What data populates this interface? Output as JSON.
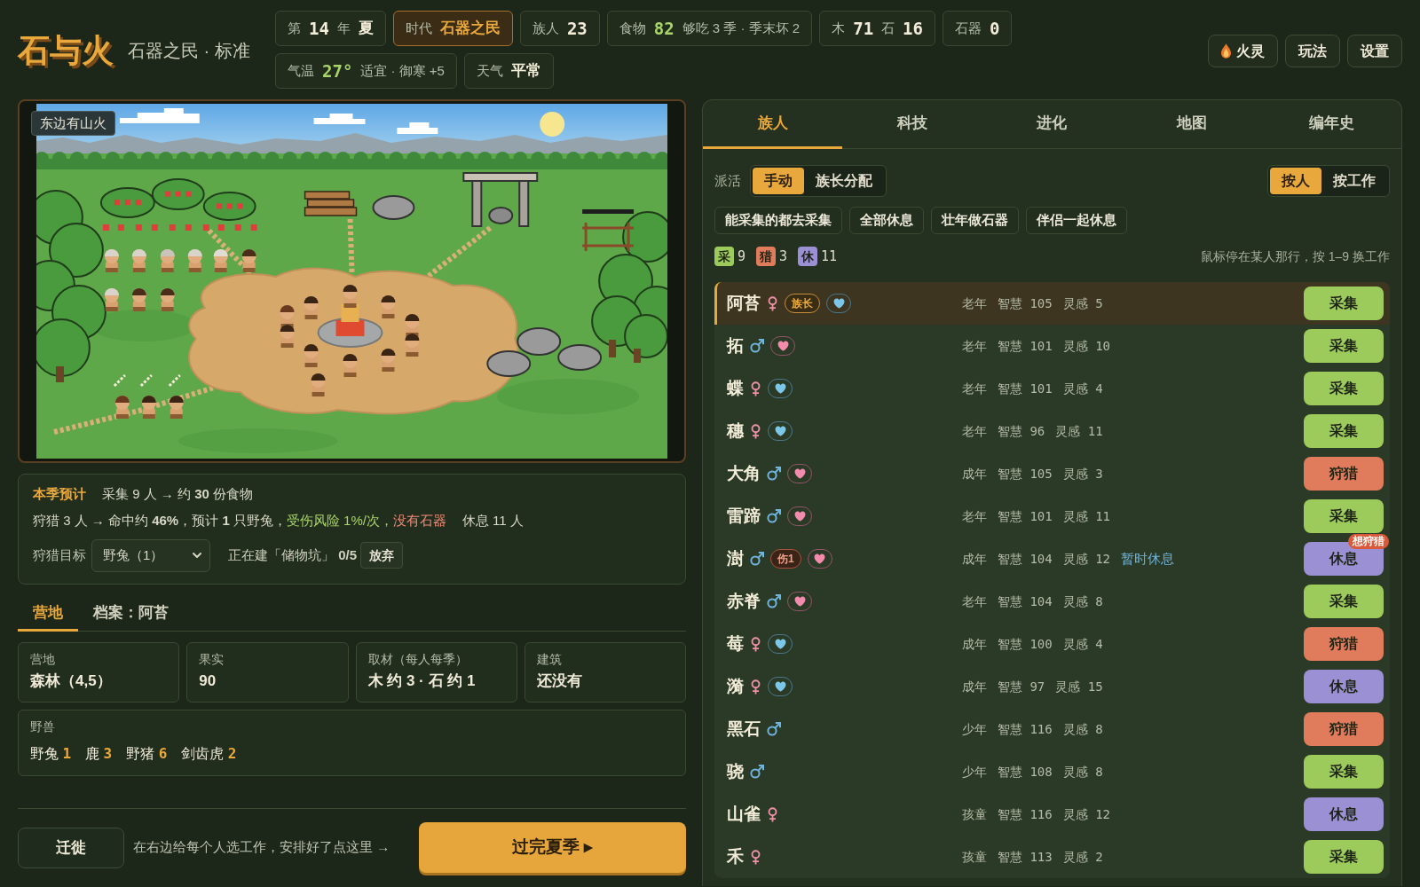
{
  "header": {
    "logo": "石与火",
    "subtitle": "石器之民 · 标准"
  },
  "status_rows": [
    {
      "chips": [
        {
          "highlighted": false,
          "parts": [
            {
              "text": "第",
              "kind": "label"
            },
            {
              "text": "14",
              "kind": "number"
            },
            {
              "text": "年",
              "kind": "label"
            },
            {
              "text": "夏",
              "kind": "value"
            }
          ]
        },
        {
          "highlighted": true,
          "parts": [
            {
              "text": "时代",
              "kind": "label"
            },
            {
              "text": "石器之民",
              "kind": "accent"
            }
          ]
        },
        {
          "highlighted": false,
          "parts": [
            {
              "text": "族人",
              "kind": "label"
            },
            {
              "text": "23",
              "kind": "number"
            }
          ]
        },
        {
          "highlighted": false,
          "parts": [
            {
              "text": "食物",
              "kind": "label"
            },
            {
              "text": "82",
              "kind": "good"
            },
            {
              "text": "够吃 3 季 · 季末坏 2",
              "kind": "label"
            }
          ]
        },
        {
          "highlighted": false,
          "parts": [
            {
              "text": "木",
              "kind": "label"
            },
            {
              "text": "71",
              "kind": "number"
            },
            {
              "text": "石",
              "kind": "label"
            },
            {
              "text": "16",
              "kind": "number"
            }
          ]
        },
        {
          "highlighted": false,
          "parts": [
            {
              "text": "石器",
              "kind": "label"
            },
            {
              "text": "0",
              "kind": "number"
            }
          ]
        }
      ]
    },
    {
      "chips": [
        {
          "highlighted": false,
          "parts": [
            {
              "text": "气温",
              "kind": "label"
            },
            {
              "text": "27°",
              "kind": "good"
            },
            {
              "text": "适宜 · 御寒 +5",
              "kind": "label"
            }
          ]
        },
        {
          "highlighted": false,
          "parts": [
            {
              "text": "天气",
              "kind": "label"
            },
            {
              "text": "平常",
              "kind": "value"
            }
          ]
        }
      ]
    }
  ],
  "top_buttons": [
    {
      "label": "火灵",
      "icon": true
    },
    {
      "label": "玩法",
      "icon": false
    },
    {
      "label": "设置",
      "icon": false
    }
  ],
  "scene": {
    "banner": "东边有山火"
  },
  "forecast": {
    "title": "本季预计",
    "gather_line": "采集 9 人 → 约 **30** 份食物",
    "hunt_line": [
      {
        "text": "狩猎 3 人 → 命中约 **46%**，预计 **1** 只野兔，",
        "kind": "normal"
      },
      {
        "text": "受伤风险 1%/次，",
        "kind": "good"
      },
      {
        "text": "没有石器",
        "kind": "bad"
      }
    ],
    "rest_line": "休息 11 人",
    "target_label": "狩猎目标",
    "target_value": "野兔（1）",
    "building": "正在建「储物坑」 **0/5**",
    "abandon_button": "放弃"
  },
  "camp_tabs": [
    {
      "label": "营地",
      "selected": true
    },
    {
      "label": "档案：阿苔",
      "selected": false
    }
  ],
  "camp_cards": [
    {
      "label": "营地",
      "value": "森林（4,5）"
    },
    {
      "label": "果实",
      "value": "90"
    },
    {
      "label": "取材（每人每季）",
      "value": "木 约 3 · 石 约 1"
    },
    {
      "label": "建筑",
      "value": "还没有"
    }
  ],
  "wildlife": {
    "label": "野兽",
    "animals": [
      {
        "name": "野兔",
        "count": "1"
      },
      {
        "name": "鹿",
        "count": "3"
      },
      {
        "name": "野猪",
        "count": "6"
      },
      {
        "name": "剑齿虎",
        "count": "2"
      }
    ]
  },
  "footer": {
    "migrate_button": "迁徙",
    "hint": "在右边给每个人选工作，安排好了点这里 →",
    "end_season_button": "过完夏季 ▸"
  },
  "panel_tabs": [
    {
      "label": "族人",
      "selected": true
    },
    {
      "label": "科技",
      "selected": false
    },
    {
      "label": "进化",
      "selected": false
    },
    {
      "label": "地图",
      "selected": false
    },
    {
      "label": "编年史",
      "selected": false
    }
  ],
  "assign": {
    "label": "派活",
    "modes": [
      {
        "label": "手动",
        "selected": true
      },
      {
        "label": "族长分配",
        "selected": false
      }
    ]
  },
  "view_modes": [
    {
      "label": "按人",
      "selected": true
    },
    {
      "label": "按工作",
      "selected": false
    }
  ],
  "quick_actions": [
    "能采集的都去采集",
    "全部休息",
    "壮年做石器",
    "伴侣一起休息"
  ],
  "job_counts": [
    {
      "label": "采",
      "count": "9",
      "color": "#9ccb5c"
    },
    {
      "label": "猎",
      "count": "3",
      "color": "#e07b5c"
    },
    {
      "label": "休",
      "count": "11",
      "color": "#9b90d4"
    }
  ],
  "hotkey_hint": "鼠标停在某人那行，按 1–9 换工作",
  "members": [
    {
      "name": "阿苔",
      "kind": "female",
      "tags": [
        {
          "text": "族长",
          "kind": "chief"
        }
      ],
      "heart": {
        "color": "#7cc6e8"
      },
      "stats": [
        "老年",
        "智慧 105",
        "灵感 5"
      ],
      "job": {
        "label": "采集",
        "kind": "gather"
      },
      "selected": true
    },
    {
      "name": "拓",
      "kind": "male",
      "heart": {
        "color": "#f28bac"
      },
      "stats": [
        "老年",
        "智慧 101",
        "灵感 10"
      ],
      "job": {
        "label": "采集",
        "kind": "gather"
      },
      "selected": false
    },
    {
      "name": "蝶",
      "kind": "female",
      "heart": {
        "color": "#7cc6e8"
      },
      "stats": [
        "老年",
        "智慧 101",
        "灵感 4"
      ],
      "job": {
        "label": "采集",
        "kind": "gather"
      },
      "selected": false
    },
    {
      "name": "穗",
      "kind": "female",
      "heart": {
        "color": "#7cc6e8"
      },
      "stats": [
        "老年",
        "智慧 96",
        "灵感 11"
      ],
      "job": {
        "label": "采集",
        "kind": "gather"
      },
      "selected": false
    },
    {
      "name": "大角",
      "kind": "male",
      "heart": {
        "color": "#f28bac"
      },
      "stats": [
        "成年",
        "智慧 105",
        "灵感 3"
      ],
      "job": {
        "label": "狩猎",
        "kind": "hunt"
      },
      "selected": false
    },
    {
      "name": "雷蹄",
      "kind": "male",
      "heart": {
        "color": "#f28bac"
      },
      "stats": [
        "老年",
        "智慧 101",
        "灵感 11"
      ],
      "job": {
        "label": "采集",
        "kind": "gather"
      },
      "selected": false
    },
    {
      "name": "澍",
      "kind": "male",
      "tags": [
        {
          "text": "伤1",
          "kind": "injury"
        }
      ],
      "heart": {
        "color": "#f28bac"
      },
      "stats": [
        "成年",
        "智慧 104",
        "灵感 12"
      ],
      "status": "暂时休息",
      "job": {
        "label": "休息",
        "kind": "rest",
        "wish": "想狩猎"
      },
      "selected": false
    },
    {
      "name": "赤脊",
      "kind": "male",
      "heart": {
        "color": "#f28bac"
      },
      "stats": [
        "老年",
        "智慧 104",
        "灵感 8"
      ],
      "job": {
        "label": "采集",
        "kind": "gather"
      },
      "selected": false
    },
    {
      "name": "莓",
      "kind": "female",
      "heart": {
        "color": "#7cc6e8"
      },
      "stats": [
        "成年",
        "智慧 100",
        "灵感 4"
      ],
      "job": {
        "label": "狩猎",
        "kind": "hunt"
      },
      "selected": false
    },
    {
      "name": "漪",
      "kind": "female",
      "heart": {
        "color": "#7cc6e8"
      },
      "stats": [
        "成年",
        "智慧 97",
        "灵感 15"
      ],
      "job": {
        "label": "休息",
        "kind": "rest"
      },
      "selected": false
    },
    {
      "name": "黑石",
      "kind": "male",
      "stats": [
        "少年",
        "智慧 116",
        "灵感 8"
      ],
      "job": {
        "label": "狩猎",
        "kind": "hunt"
      },
      "selected": false
    },
    {
      "name": "骁",
      "kind": "male",
      "stats": [
        "少年",
        "智慧 108",
        "灵感 8"
      ],
      "job": {
        "label": "采集",
        "kind": "gather"
      },
      "selected": false
    },
    {
      "name": "山雀",
      "kind": "female",
      "stats": [
        "孩童",
        "智慧 116",
        "灵感 12"
      ],
      "job": {
        "label": "休息",
        "kind": "rest"
      },
      "selected": false
    },
    {
      "name": "禾",
      "kind": "female",
      "stats": [
        "孩童",
        "智慧 113",
        "灵感 2"
      ],
      "job": {
        "label": "采集",
        "kind": "gather"
      },
      "selected": false
    }
  ]
}
